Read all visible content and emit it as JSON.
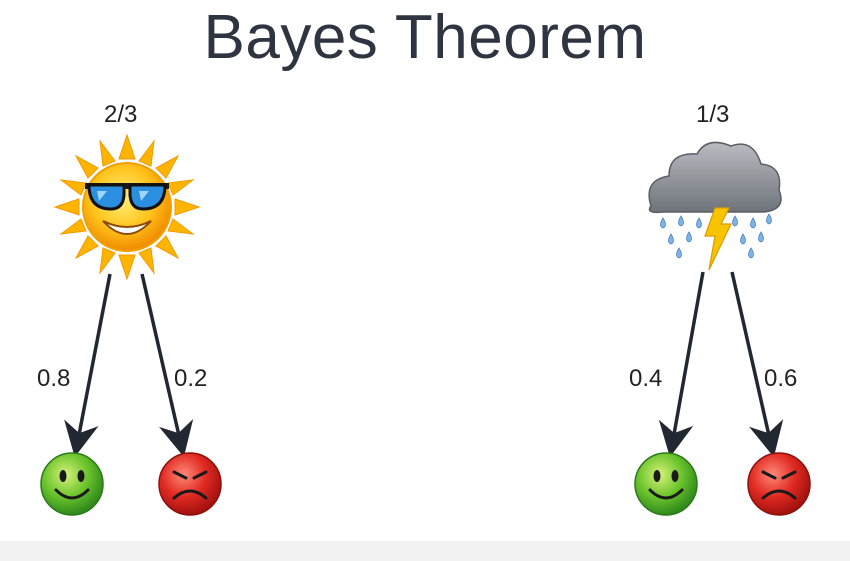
{
  "title": "Bayes Theorem",
  "branches": [
    {
      "weather": "sun-icon",
      "prior": "2/3",
      "to_happy": "0.8",
      "to_sad": "0.2"
    },
    {
      "weather": "storm-cloud-icon",
      "prior": "1/3",
      "to_happy": "0.4",
      "to_sad": "0.6"
    }
  ],
  "colors": {
    "arrow": "#222831",
    "happy": "#5cbf2a",
    "sad": "#d9232a",
    "sun": "#f8b800",
    "cloud": "#8a8f96",
    "rain": "#6fa3d8",
    "lightning": "#f5c000"
  }
}
